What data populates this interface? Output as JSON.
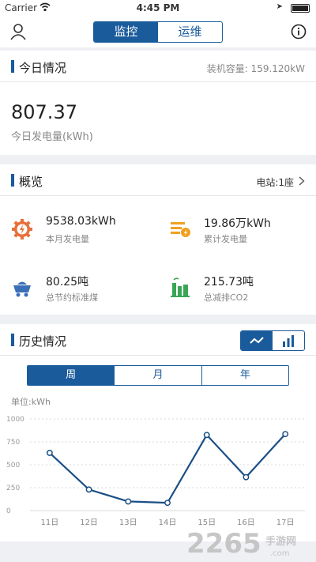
{
  "status": {
    "carrier": "Carrier",
    "time": "4:45 PM"
  },
  "nav": {
    "tabs": [
      {
        "label": "监控",
        "active": true
      },
      {
        "label": "运维",
        "active": false
      }
    ]
  },
  "today": {
    "title": "今日情况",
    "capacity": "装机容量: 159.120kW",
    "value": "807.37",
    "label": "今日发电量(kWh)"
  },
  "overview": {
    "title": "概览",
    "stations": "电站:1座",
    "stats": [
      {
        "value": "9538.03kWh",
        "label": "本月发电量",
        "icon": "gear-bolt-icon",
        "color": "#e8703a"
      },
      {
        "value": "19.86万kWh",
        "label": "累计发电量",
        "icon": "stack-bolt-icon",
        "color": "#f0a020"
      },
      {
        "value": "80.25吨",
        "label": "总节约标准煤",
        "icon": "coal-cart-icon",
        "color": "#3b6fb6"
      },
      {
        "value": "215.73吨",
        "label": "总减排CO2",
        "icon": "factory-icon",
        "color": "#3aa655"
      }
    ]
  },
  "history": {
    "title": "历史情况",
    "periods": [
      {
        "label": "周",
        "active": true
      },
      {
        "label": "月",
        "active": false
      },
      {
        "label": "年",
        "active": false
      }
    ],
    "unit": "单位:kWh"
  },
  "watermark": {
    "text": "2265",
    "sub": "手游网",
    "domain": ".com"
  },
  "chart_data": {
    "type": "line",
    "x": [
      "11日",
      "12日",
      "13日",
      "14日",
      "15日",
      "16日",
      "17日"
    ],
    "values": [
      630,
      230,
      100,
      85,
      825,
      365,
      835
    ],
    "yticks": [
      0,
      250,
      500,
      750,
      1000
    ],
    "ylim": [
      0,
      1000
    ],
    "color": "#1a4f86"
  }
}
